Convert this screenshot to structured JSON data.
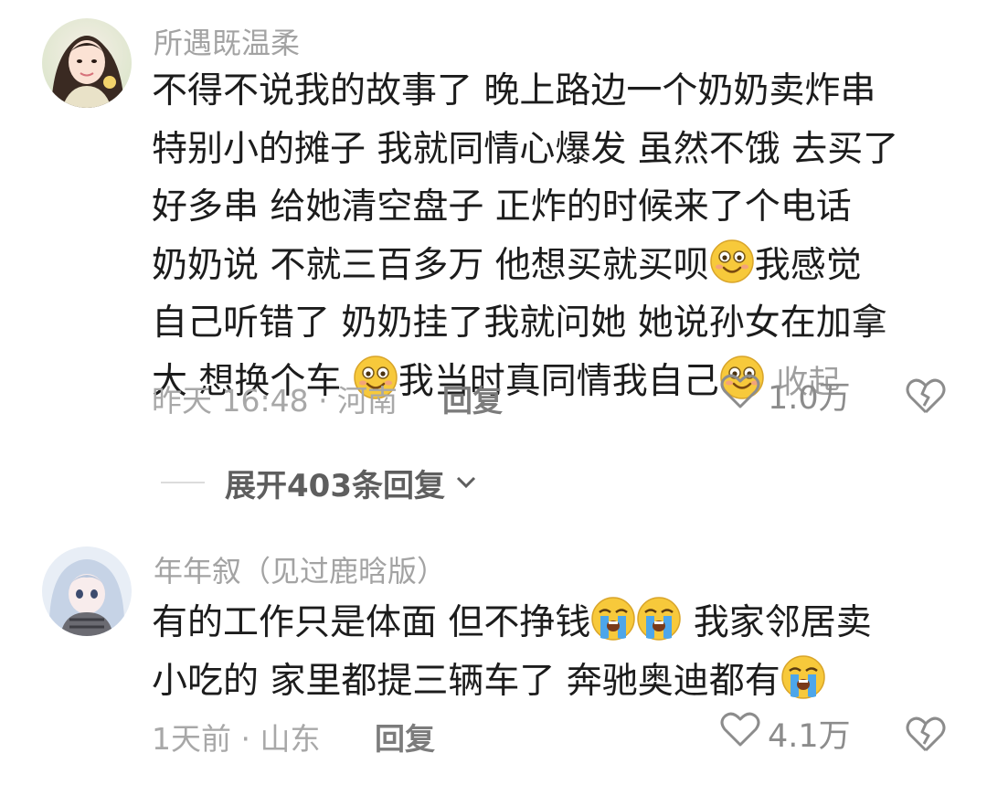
{
  "comments": [
    {
      "username": "所遇既温柔",
      "avatar": "girl-avatar",
      "lines": [
        [
          "不得不说我的故事了  晚上路边一个奶奶卖炸串"
        ],
        [
          "特别小的摊子 我就同情心爆发 虽然不饿 去买了"
        ],
        [
          "好多串  给她清空盘子 正炸的时候来了个电话"
        ],
        [
          "奶奶说 不就三百多万 他想买就买呗",
          "我感觉"
        ],
        [
          "自己听错了 奶奶挂了我就问她 她说孙女在加拿"
        ],
        [
          "大 想换个车 ",
          "我当时真同情我自己",
          ""
        ]
      ],
      "emoji": "grin-emoji",
      "collapse_label": "收起",
      "time_location": "昨天 16:48 · 河南",
      "reply_label": "回复",
      "likes": "1.0万"
    },
    {
      "username": "年年叙（见过鹿晗版）",
      "avatar": "anime-avatar",
      "lines": [
        [
          "有的工作只是体面 但不挣钱",
          "",
          " 我家邻居卖"
        ],
        [
          "小吃的 家里都提三辆车了 奔驰奥迪都有",
          ""
        ]
      ],
      "emoji": "crying-emoji",
      "time_location": "1天前 · 山东",
      "reply_label": "回复",
      "likes": "4.1万"
    }
  ],
  "expand_replies": {
    "label": "展开403条回复"
  },
  "colors": {
    "meta_gray": "#a8a8a8",
    "text": "#1c1c1c",
    "emoji_yellow": "#f7c93b",
    "tear_blue": "#4da6ea"
  }
}
